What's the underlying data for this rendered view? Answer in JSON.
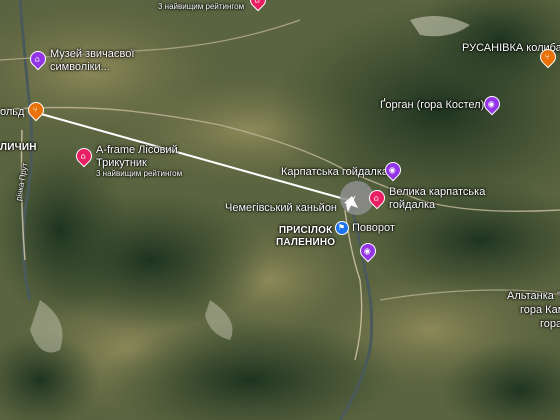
{
  "colors": {
    "poi_purple": "#9334e6",
    "poi_pink": "#e91e63",
    "poi_orange": "#e8710a",
    "turn_blue": "#1a73e8",
    "route_line": "#ffffff"
  },
  "top_fragment": {
    "rating_text": "3 найвищим рейтингом"
  },
  "pois": {
    "museum": {
      "line1": "Музей звичаєвої",
      "line2": "символіки...",
      "icon": "museum-icon"
    },
    "afr": {
      "line1": "A-frame Лісовий",
      "line2": "Трикутник",
      "rating": "3 найвищим рейтингом",
      "icon": "hotel-icon"
    },
    "rusanivka": {
      "name": "РУСАНІВКА колиба",
      "icon": "restaurant-icon"
    },
    "gorgan": {
      "name": "Ґорган (гора Костел)",
      "icon": "camera-icon"
    },
    "karpatska": {
      "name": "Карпатська гойдалка",
      "icon": "camera-icon"
    },
    "velyka": {
      "line1": "Велика карпатська",
      "line2": "гойдалка",
      "icon": "hotel-icon"
    },
    "canyon": {
      "name": "Чемегівський каньйон",
      "icon": "camera-icon"
    },
    "povorot": {
      "name": "Поворот",
      "icon": "flag-icon"
    },
    "koldfragment": {
      "name": "ольд",
      "icon": "restaurant-icon"
    }
  },
  "places": {
    "lychyn": "ЛИЧИН",
    "prysilok_line1": "ПРИСІЛОК",
    "prysilok_line2": "ПАЛЕНИНО"
  },
  "roads": {
    "rivne_prut": "річка Прут"
  },
  "edge_labels": {
    "altanka": "Альтанка \"М",
    "gora_kam": "гора Кам",
    "gora_g": "гора Ґ"
  }
}
